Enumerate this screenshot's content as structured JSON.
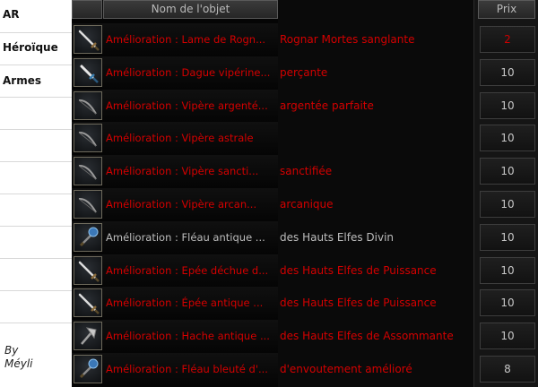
{
  "sidebar": {
    "labels": [
      "AR",
      "Héroïque",
      "Armes"
    ],
    "credit_line1": "By",
    "credit_line2": "Méyli"
  },
  "table": {
    "header_name": "Nom de l'objet",
    "header_price": "Prix",
    "rows": [
      {
        "name": "Amélioration : Lame de Rogn...",
        "continuation": "Rognar Mortes sanglante",
        "price": "2",
        "color": "#d40000",
        "icon": "sword-icon"
      },
      {
        "name": "Amélioration : Dague vipérine...",
        "continuation": "perçante",
        "price": "10",
        "color": "#d40000",
        "icon": "dagger-icon"
      },
      {
        "name": "Amélioration : Vipère argenté...",
        "continuation": "argentée parfaite",
        "price": "10",
        "color": "#d40000",
        "icon": "bow-icon"
      },
      {
        "name": "Amélioration : Vipère astrale",
        "continuation": "",
        "price": "10",
        "color": "#d40000",
        "icon": "bow-icon"
      },
      {
        "name": "Amélioration : Vipère sancti...",
        "continuation": "sanctifiée",
        "price": "10",
        "color": "#d40000",
        "icon": "bow-icon"
      },
      {
        "name": "Amélioration : Vipère arcan...",
        "continuation": "arcanique",
        "price": "10",
        "color": "#d40000",
        "icon": "bow-icon"
      },
      {
        "name": "Amélioration : Fléau antique ...",
        "continuation": "des Hauts Elfes Divin",
        "price": "10",
        "color": "#bdbdbd",
        "icon": "mace-icon"
      },
      {
        "name": "Amélioration : Epée déchue d...",
        "continuation": "des Hauts Elfes de Puissance",
        "price": "10",
        "color": "#d40000",
        "icon": "sword-icon"
      },
      {
        "name": "Amélioration : Épée antique ...",
        "continuation": "des Hauts Elfes de Puissance",
        "price": "10",
        "color": "#d40000",
        "icon": "sword-icon"
      },
      {
        "name": "Amélioration : Hache antique ...",
        "continuation": "des Hauts Elfes de Assommante",
        "price": "10",
        "color": "#d40000",
        "icon": "axe-icon"
      },
      {
        "name": "Amélioration : Fléau bleuté d'...",
        "continuation": "d'envoutement amélioré",
        "price": "8",
        "color": "#d40000",
        "icon": "mace-icon"
      }
    ]
  },
  "colors": {
    "red_text": "#d40000",
    "grey_text": "#bdbdbd",
    "price_red": "#cc0000",
    "price_grey": "#c8c8c8"
  }
}
